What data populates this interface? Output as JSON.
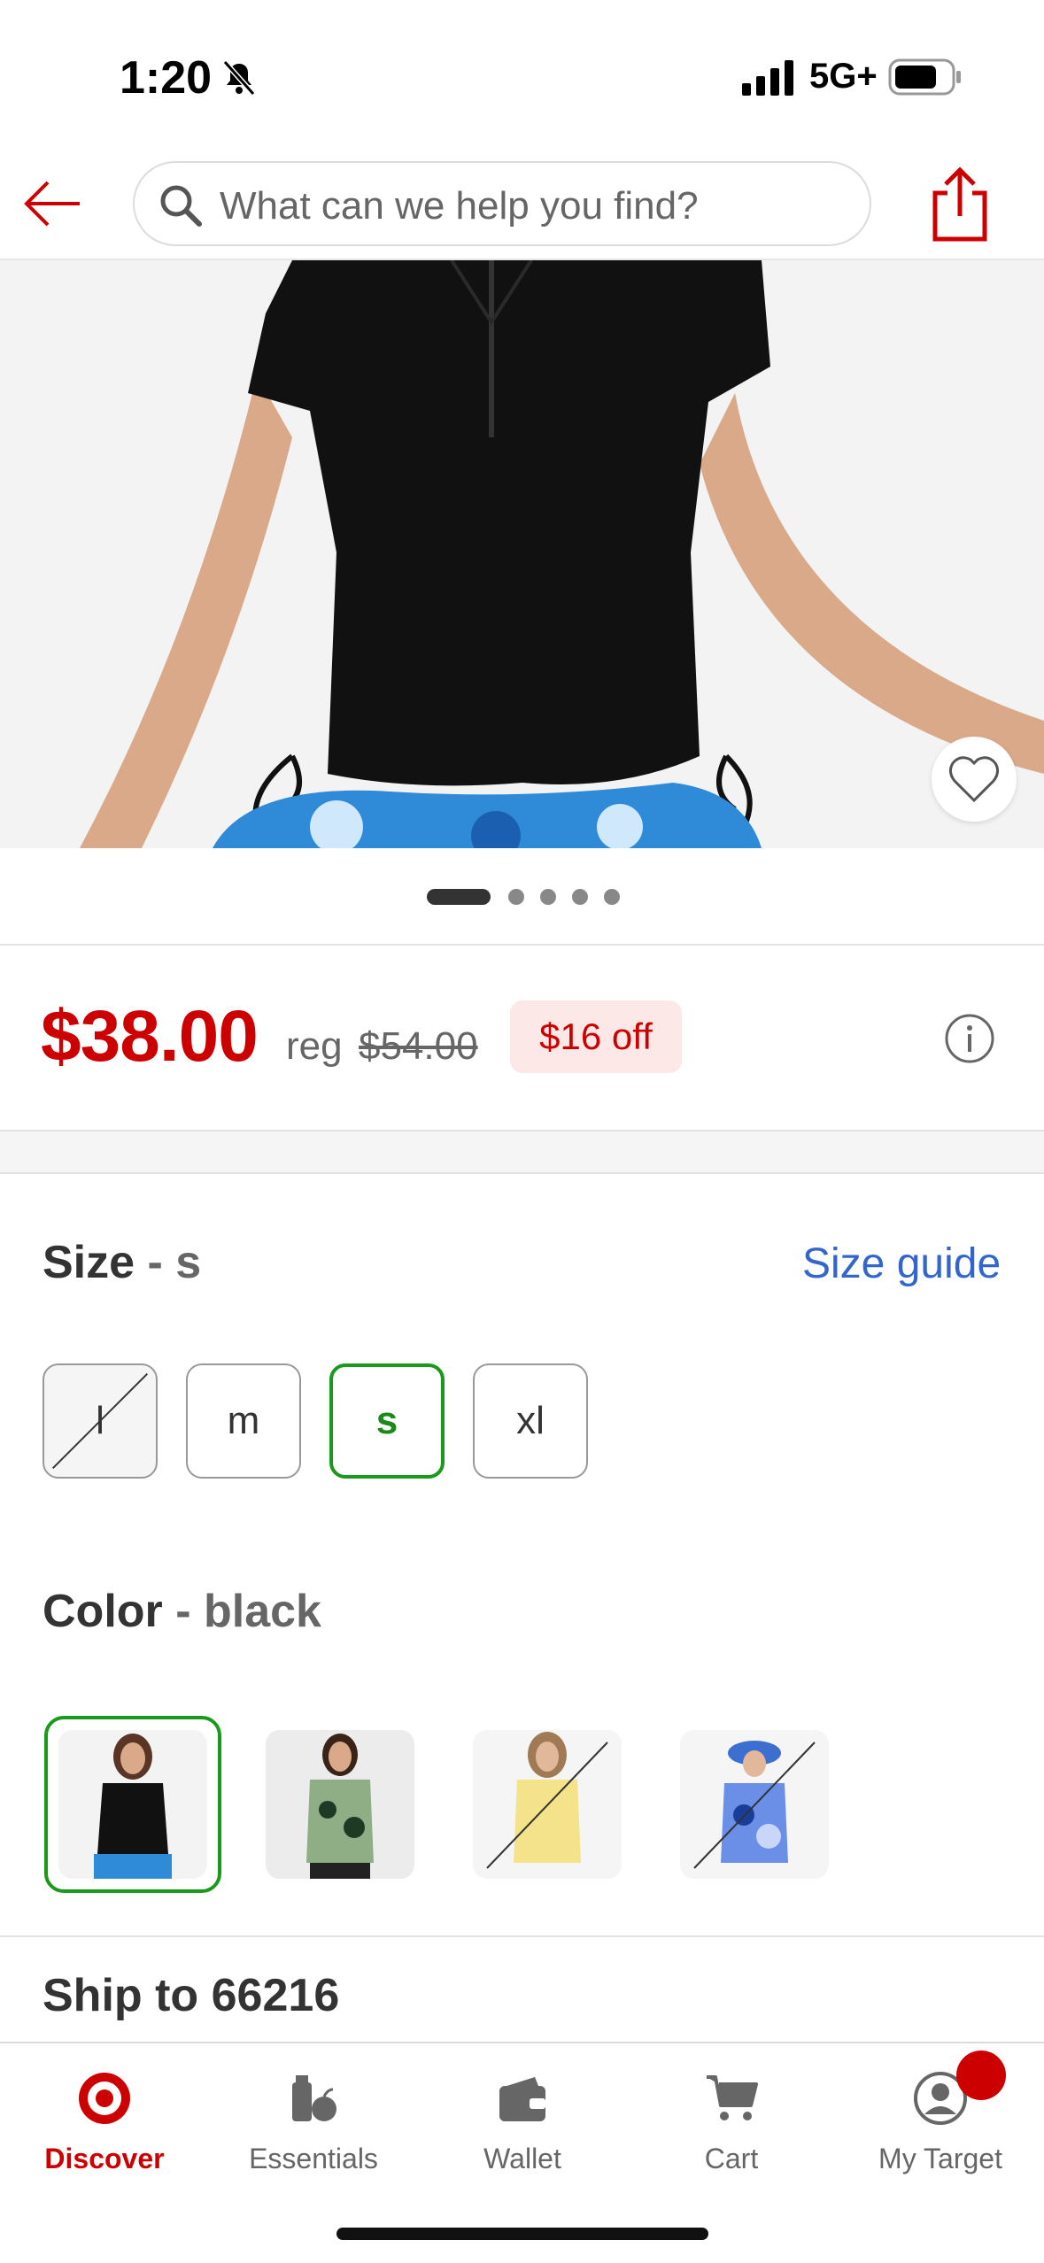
{
  "status_bar": {
    "time": "1:20",
    "network": "5G+"
  },
  "header": {
    "search_placeholder": "What can we help you find?"
  },
  "gallery": {
    "image_count": 5,
    "active_index": 0
  },
  "price": {
    "current": "$38.00",
    "reg_label": "reg",
    "reg_price": "$54.00",
    "discount": "$16 off"
  },
  "size": {
    "label": "Size",
    "separator": " - ",
    "selected": "s",
    "guide_link": "Size guide",
    "options": [
      {
        "label": "l",
        "available": false,
        "selected": false
      },
      {
        "label": "m",
        "available": true,
        "selected": false
      },
      {
        "label": "s",
        "available": true,
        "selected": true
      },
      {
        "label": "xl",
        "available": true,
        "selected": false
      }
    ]
  },
  "color": {
    "label": "Color",
    "separator": " - ",
    "selected": "black",
    "options": [
      {
        "name": "black",
        "available": true,
        "selected": true
      },
      {
        "name": "green floral",
        "available": true,
        "selected": false
      },
      {
        "name": "yellow",
        "available": false,
        "selected": false
      },
      {
        "name": "blue floral",
        "available": false,
        "selected": false
      }
    ]
  },
  "shipping": {
    "label": "Ship to 66216"
  },
  "bottom_nav": {
    "items": [
      {
        "label": "Discover",
        "icon": "target-bullseye-icon",
        "active": true
      },
      {
        "label": "Essentials",
        "icon": "essentials-icon",
        "active": false
      },
      {
        "label": "Wallet",
        "icon": "wallet-icon",
        "active": false
      },
      {
        "label": "Cart",
        "icon": "cart-icon",
        "active": false
      },
      {
        "label": "My Target",
        "icon": "account-icon",
        "active": false
      }
    ]
  },
  "colors": {
    "brand_red": "#cc0000",
    "selected_green": "#1a9a1a",
    "link_blue": "#3366cc"
  }
}
